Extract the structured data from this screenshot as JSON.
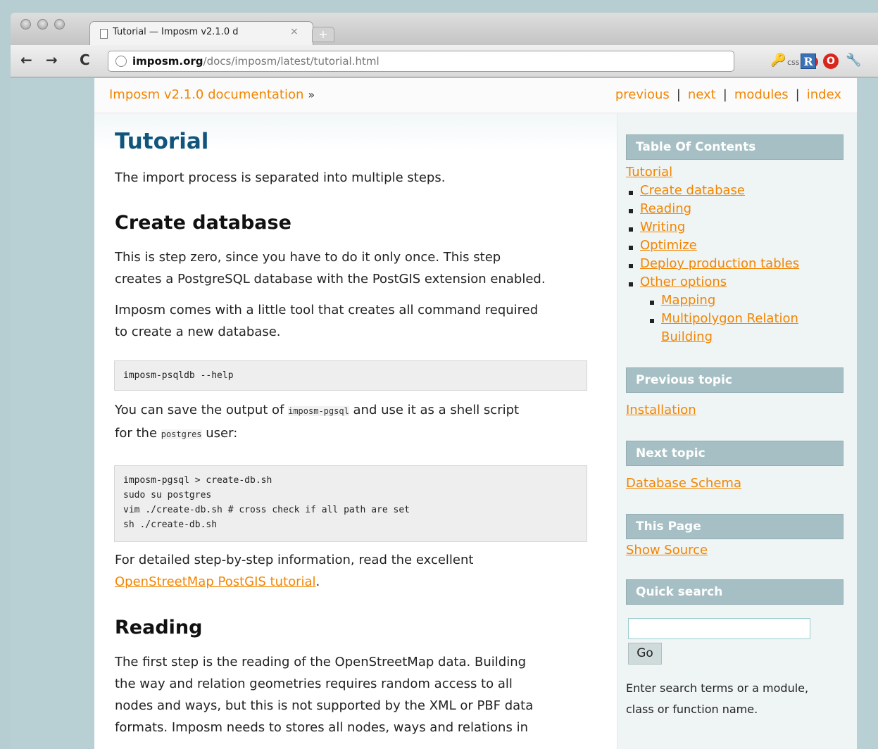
{
  "browser": {
    "tab_title": "Tutorial — Imposm v2.1.0 d",
    "tab_close": "×",
    "new_tab": "+",
    "nav": {
      "back": "←",
      "forward": "→",
      "reload": "C"
    },
    "url_host": "imposm.org",
    "url_path": "/docs/imposm/latest/tutorial.html",
    "css_label": "css",
    "ext_r_label": "R",
    "ext_o_label": "O"
  },
  "related": {
    "home_link": "Imposm v2.1.0 documentation",
    "raquo": "»",
    "links": [
      "previous",
      "next",
      "modules",
      "index"
    ],
    "separator": "|"
  },
  "content": {
    "title": "Tutorial",
    "intro": "The import process is separated into multiple steps.",
    "create_db": {
      "heading": "Create database",
      "p1_line1": "This is step zero, since you have to do it only once. This step",
      "p1_line2": "creates a PostgreSQL database with the PostGIS extension enabled.",
      "p2_line1": "Imposm comes with a little tool that creates all command required",
      "p2_line2": "to create a new database.",
      "code1": "imposm-psqldb --help",
      "p3_a": "You can save the output of ",
      "p3_code": "imposm-pgsql",
      "p3_b": " and use it as a shell script",
      "p3_c": "for the ",
      "p3_code2": "postgres",
      "p3_d": " user:",
      "code2": "imposm-pgsql > create-db.sh\nsudo su postgres\nvim ./create-db.sh # cross check if all path are set\nsh ./create-db.sh",
      "p4_line1": "For detailed step-by-step information, read the excellent",
      "p4_link": "OpenStreetMap PostGIS tutorial",
      "p4_end": "."
    },
    "reading": {
      "heading": "Reading",
      "line1": "The first step is the reading of the OpenStreetMap data. Building",
      "line2": "the way and relation geometries requires random access to all",
      "line3": "nodes and ways, but this is not supported by the XML or PBF data",
      "line4": "formats. Imposm needs to stores all nodes, ways and relations in"
    }
  },
  "sidebar": {
    "toc_heading": "Table Of Contents",
    "toc_root": "Tutorial",
    "toc_items": [
      "Create database",
      "Reading",
      "Writing",
      "Optimize",
      "Deploy production tables",
      "Other options"
    ],
    "toc_sub_items": [
      "Mapping",
      "Multipolygon Relation",
      "Building"
    ],
    "prev_heading": "Previous topic",
    "prev_link": "Installation",
    "next_heading": "Next topic",
    "next_link": "Database Schema",
    "this_page_heading": "This Page",
    "show_source": "Show Source",
    "search_heading": "Quick search",
    "search_value": "",
    "go_label": "Go",
    "search_hint_line1": "Enter search terms or a module,",
    "search_hint_line2": "class or function name."
  },
  "colors": {
    "link": "#f28500",
    "title": "#11557c",
    "sidebar_head": "#a6bfc4",
    "backdrop": "#b6cdd1"
  }
}
